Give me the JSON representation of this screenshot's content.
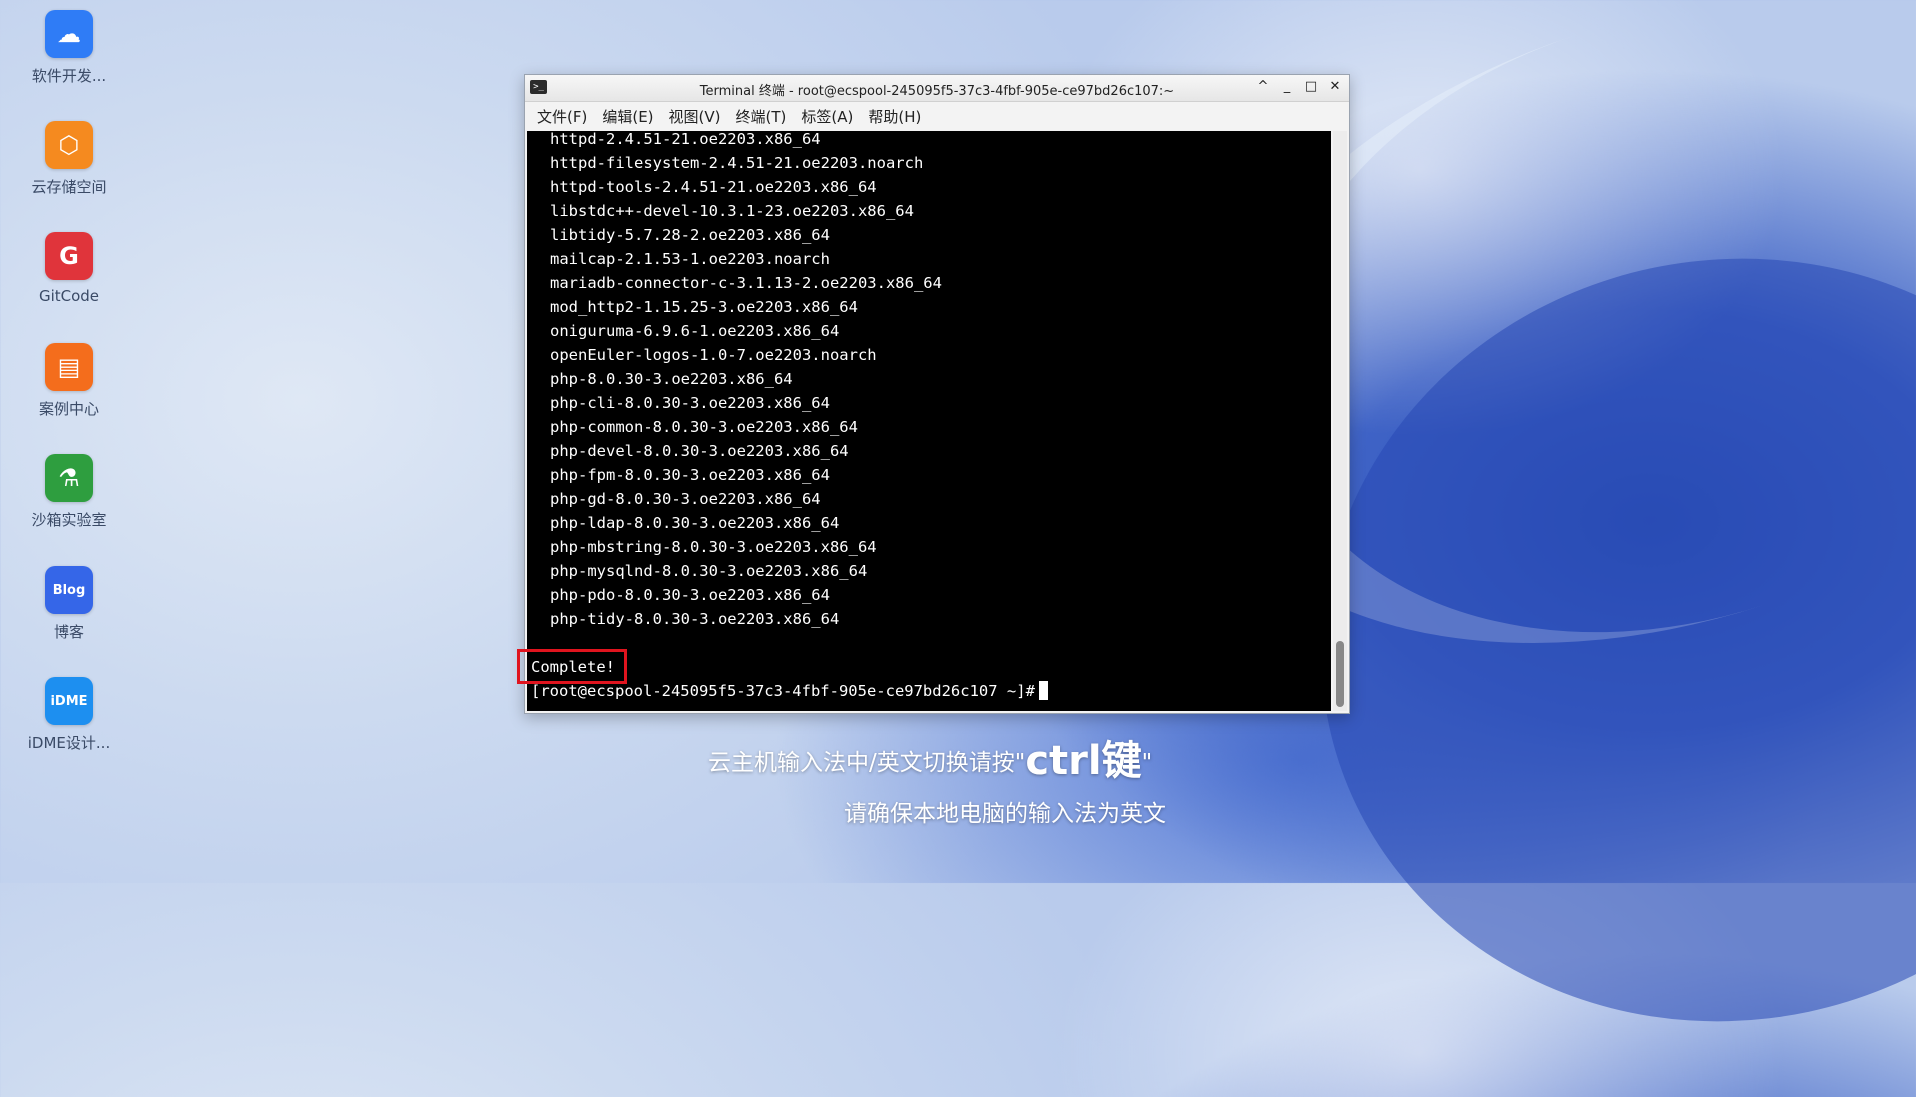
{
  "desktop": {
    "icons": [
      {
        "label": "软件开发...",
        "glyph": "☁",
        "color": "#2f7cf6",
        "icon": "cloud-dev-icon"
      },
      {
        "label": "云存储空间",
        "glyph": "⬡",
        "color": "#f58a1f",
        "icon": "cloud-storage-icon"
      },
      {
        "label": "GitCode",
        "glyph": "G",
        "color": "#e0343b",
        "icon": "gitcode-icon"
      },
      {
        "label": "案例中心",
        "glyph": "▤",
        "color": "#f46d1c",
        "icon": "case-center-icon"
      },
      {
        "label": "沙箱实验室",
        "glyph": "⚗",
        "color": "#2e9e3f",
        "icon": "sandbox-lab-icon"
      },
      {
        "label": "博客",
        "glyph": "Blog",
        "color": "#3566e8",
        "icon": "blog-icon"
      },
      {
        "label": "iDME设计...",
        "glyph": "iDME",
        "color": "#1d8ff0",
        "icon": "idme-icon"
      }
    ]
  },
  "terminal": {
    "title": "Terminal 终端 - root@ecspool-245095f5-37c3-4fbf-905e-ce97bd26c107:~",
    "window_controls": [
      "^",
      "_",
      "□",
      "✕"
    ],
    "menu": [
      "文件(F)",
      "编辑(E)",
      "视图(V)",
      "终端(T)",
      "标签(A)",
      "帮助(H)"
    ],
    "lines": [
      "httpd-2.4.51-21.oe2203.x86_64",
      "httpd-filesystem-2.4.51-21.oe2203.noarch",
      "httpd-tools-2.4.51-21.oe2203.x86_64",
      "libstdc++-devel-10.3.1-23.oe2203.x86_64",
      "libtidy-5.7.28-2.oe2203.x86_64",
      "mailcap-2.1.53-1.oe2203.noarch",
      "mariadb-connector-c-3.1.13-2.oe2203.x86_64",
      "mod_http2-1.15.25-3.oe2203.x86_64",
      "oniguruma-6.9.6-1.oe2203.x86_64",
      "openEuler-logos-1.0-7.oe2203.noarch",
      "php-8.0.30-3.oe2203.x86_64",
      "php-cli-8.0.30-3.oe2203.x86_64",
      "php-common-8.0.30-3.oe2203.x86_64",
      "php-devel-8.0.30-3.oe2203.x86_64",
      "php-fpm-8.0.30-3.oe2203.x86_64",
      "php-gd-8.0.30-3.oe2203.x86_64",
      "php-ldap-8.0.30-3.oe2203.x86_64",
      "php-mbstring-8.0.30-3.oe2203.x86_64",
      "php-mysqlnd-8.0.30-3.oe2203.x86_64",
      "php-pdo-8.0.30-3.oe2203.x86_64",
      "php-tidy-8.0.30-3.oe2203.x86_64"
    ],
    "complete": "Complete!",
    "prompt": "[root@ecspool-245095f5-37c3-4fbf-905e-ce97bd26c107 ~]#"
  },
  "overlay": {
    "line1_prefix": "云主机输入法中/英文切换请按\"",
    "line1_key": "ctrl键",
    "line1_suffix": "\"",
    "line2": "请确保本地电脑的输入法为英文"
  }
}
